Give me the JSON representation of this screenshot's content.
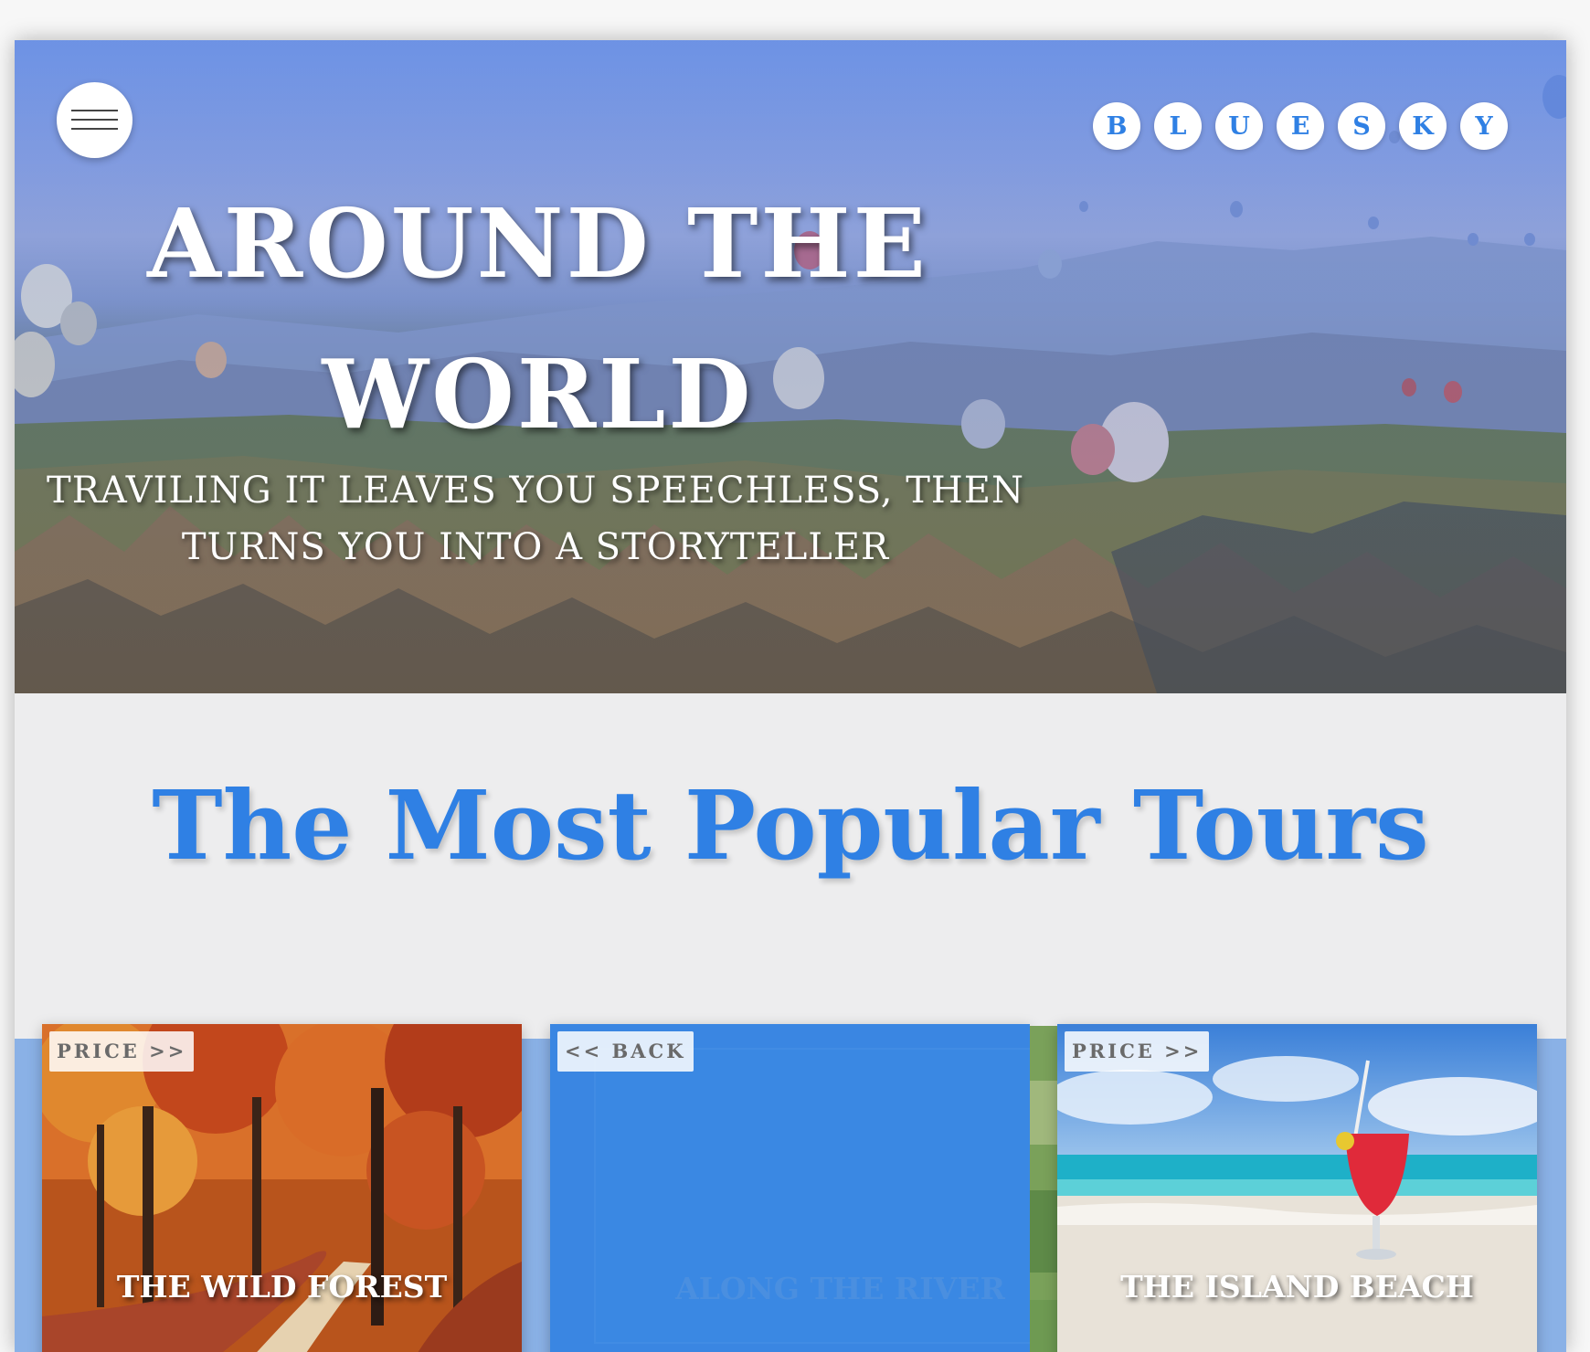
{
  "header": {
    "menu_icon": "hamburger-icon",
    "logo_letters": [
      "B",
      "L",
      "U",
      "E",
      "S",
      "K",
      "Y"
    ]
  },
  "hero": {
    "title_line1": "AROUND THE",
    "title_line2": "WORLD",
    "subtitle_line1": "TRAVILING IT LEAVES YOU SPEECHLESS, THEN",
    "subtitle_line2": "TURNS YOU INTO A STORYTELLER"
  },
  "section": {
    "title": "The Most Popular Tours"
  },
  "cards": [
    {
      "tag": "PRICE >>",
      "title": "THE WILD FOREST"
    },
    {
      "tag": "<< BACK",
      "title": "ALONG THE RIVER"
    },
    {
      "tag": "PRICE >>",
      "title": "THE ISLAND BEACH"
    }
  ],
  "colors": {
    "accent": "#2f80e4",
    "band": "#8ab1e6",
    "background": "#ededee"
  }
}
